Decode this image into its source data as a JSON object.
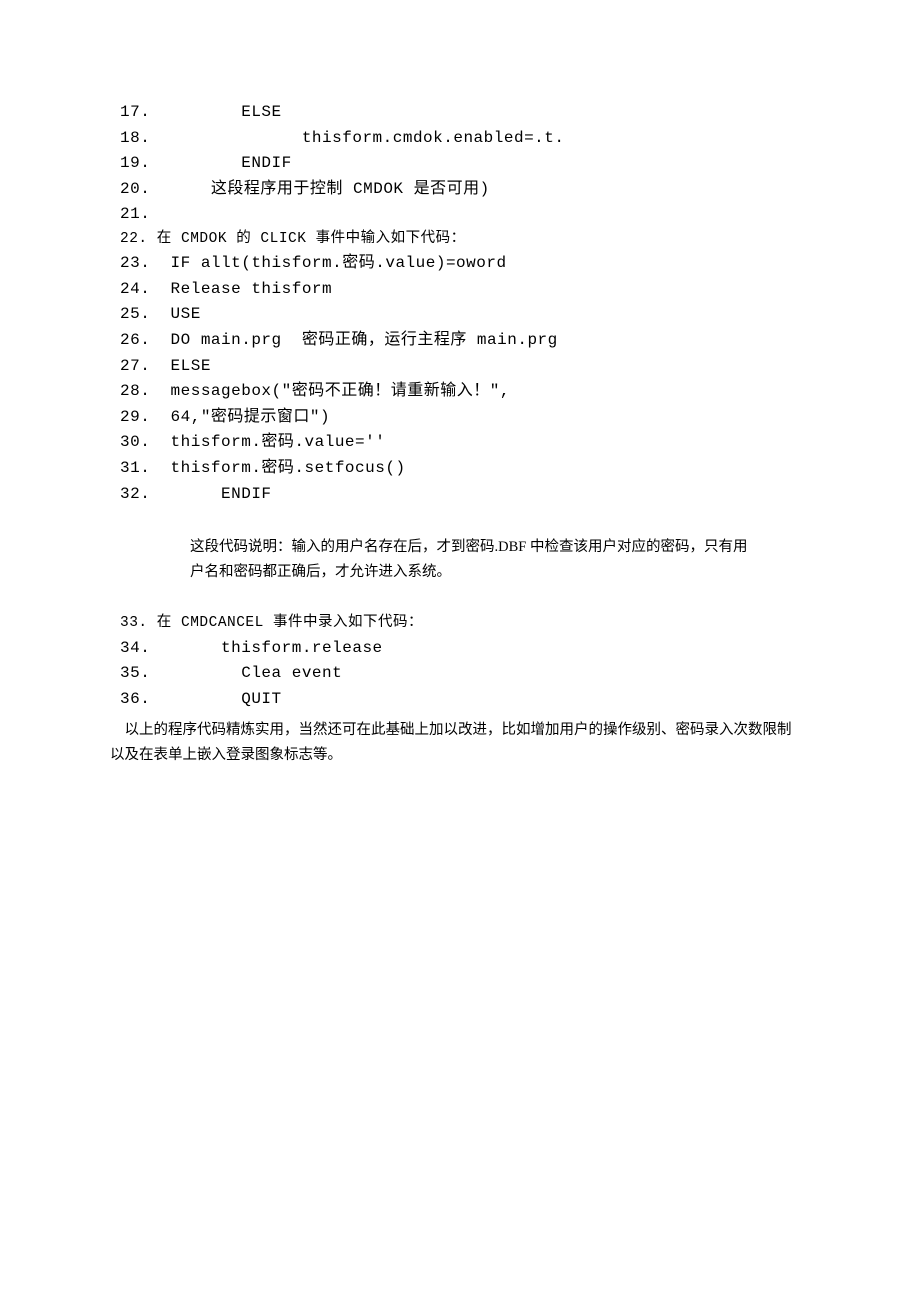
{
  "lines": {
    "l17": "17.         ELSE",
    "l18": "18.               thisform.cmdok.enabled=.t.",
    "l19": "19.         ENDIF",
    "l20": "20.      这段程序用于控制 CMDOK 是否可用)",
    "l21": "21.",
    "l22": "22. 在 CMDOK 的 CLICK 事件中输入如下代码：",
    "l23": "23.  IF allt(thisform.密码.value)=oword",
    "l24": "24.  Release thisform",
    "l25": "25.  USE",
    "l26": "26.  DO main.prg  密码正确，运行主程序 main.prg",
    "l27": "27.  ELSE",
    "l28": "28.  messagebox(\"密码不正确！请重新输入！\",",
    "l29": "29.  64,\"密码提示窗口\")",
    "l30": "30.  thisform.密码.value=''",
    "l31": "31.  thisform.密码.setfocus()",
    "l32": "32.       ENDIF"
  },
  "note1": "这段代码说明：输入的用户名存在后，才到密码.DBF 中检查该用户对应的密码，只有用户名和密码都正确后，才允许进入系统。",
  "lines2": {
    "l33": "33. 在 CMDCANCEL 事件中录入如下代码：",
    "l34": "34.       thisform.release",
    "l35": "35.         Clea event",
    "l36": "36.         QUIT"
  },
  "final": "　以上的程序代码精炼实用，当然还可在此基础上加以改进，比如增加用户的操作级别、密码录入次数限制以及在表单上嵌入登录图象标志等。"
}
